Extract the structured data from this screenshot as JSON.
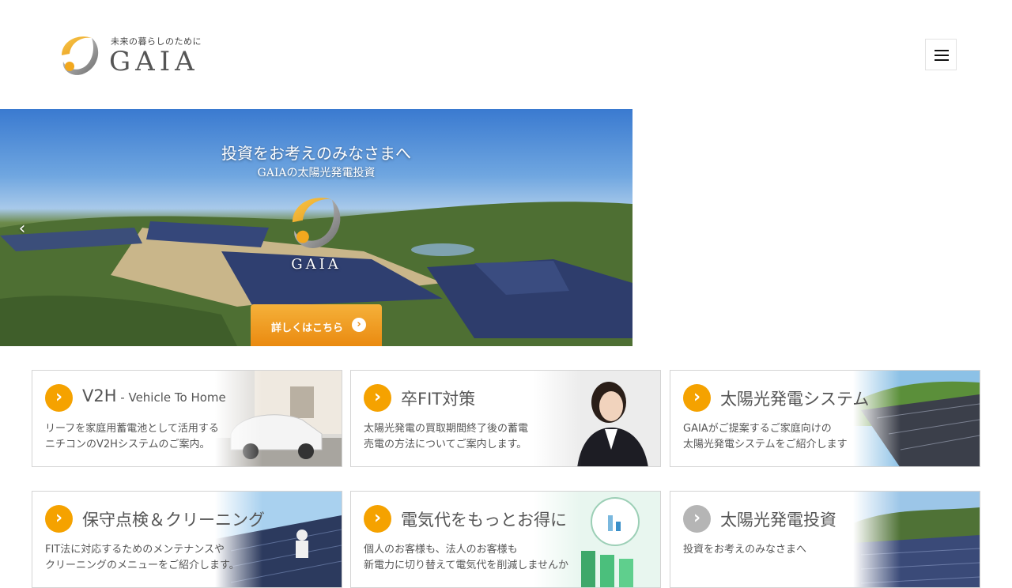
{
  "header": {
    "tagline": "未来の暮らしのために",
    "wordmark": "GAIA",
    "menu_icon": "hamburger-menu-icon"
  },
  "hero": {
    "title": "投資をお考えのみなさまへ",
    "subtitle": "GAIAの太陽光発電投資",
    "brand": "GAIA",
    "cta_label": "詳しくはこちら",
    "cta_icon": "chevron-right-circle-icon",
    "prev_icon": "chevron-left-icon",
    "cta_color": "#ea8a10"
  },
  "cards": [
    {
      "title": "V2H",
      "title_suffix": " - Vehicle To Home",
      "desc1": "リーフを家庭用蓄電池として活用する",
      "desc2": "ニチコンのV2Hシステムのご案内。",
      "arrow": "orange"
    },
    {
      "title": "卒FIT対策",
      "title_suffix": "",
      "desc1": "太陽光発電の買取期間終了後の蓄電",
      "desc2": "売電の方法についてご案内します。",
      "arrow": "orange"
    },
    {
      "title": "太陽光発電システム",
      "title_suffix": "",
      "desc1": "GAIAがご提案するご家庭向けの",
      "desc2": "太陽光発電システムをご紹介します",
      "arrow": "orange"
    },
    {
      "title": "保守点検＆クリーニング",
      "title_suffix": "",
      "desc1": "FIT法に対応するためのメンテナンスや",
      "desc2": "クリーニングのメニューをご紹介します。",
      "arrow": "orange"
    },
    {
      "title": "電気代をもっとお得に",
      "title_suffix": "",
      "desc1": "個人のお客様も、法人のお客様も",
      "desc2": "新電力に切り替えて電気代を削減しませんか",
      "arrow": "orange"
    },
    {
      "title": "太陽光発電投資",
      "title_suffix": "",
      "desc1": "投資をお考えのみなさまへ",
      "desc2": "",
      "arrow": "gray"
    }
  ],
  "colors": {
    "accent": "#f5a200",
    "text": "#555555",
    "border": "#d4d4d4"
  }
}
